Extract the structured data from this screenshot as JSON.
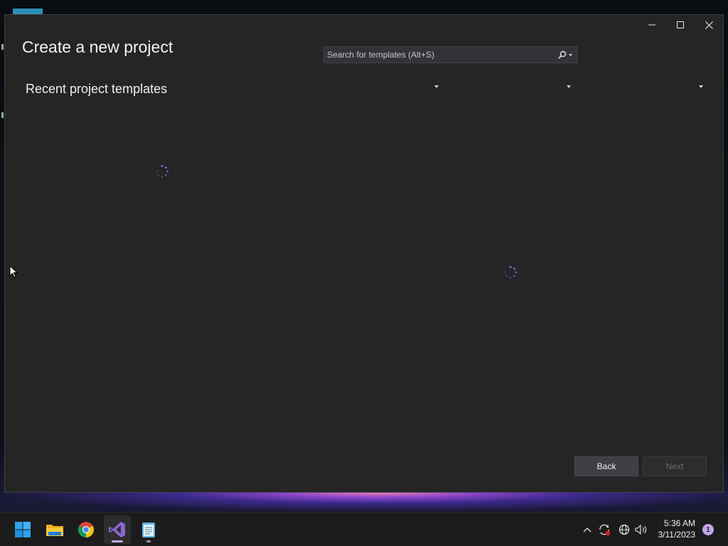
{
  "dialog": {
    "title": "Create a new project",
    "subtitle": "Recent project templates",
    "search": {
      "placeholder": "Search for templates (Alt+S)",
      "value": ""
    },
    "filters": [
      {
        "name": "language-filter",
        "value": ""
      },
      {
        "name": "platform-filter",
        "value": ""
      },
      {
        "name": "project-type-filter",
        "value": ""
      }
    ],
    "buttons": {
      "back": "Back",
      "next": "Next"
    },
    "window_controls": [
      "minimize-icon",
      "maximize-icon",
      "close-icon"
    ],
    "loading": {
      "recent_templates": true,
      "all_templates": true
    }
  },
  "taskbar": {
    "apps": [
      {
        "name": "start-button",
        "icon": "windows-logo-icon",
        "active": false
      },
      {
        "name": "file-explorer",
        "icon": "folder-icon",
        "active": false
      },
      {
        "name": "chrome",
        "icon": "chrome-icon",
        "active": false
      },
      {
        "name": "visual-studio",
        "icon": "visual-studio-icon",
        "active": true
      },
      {
        "name": "notepad",
        "icon": "notepad-icon",
        "active": false
      }
    ],
    "tray": {
      "time": "5:36 AM",
      "date": "3/11/2023",
      "notifications": "1",
      "icons": [
        "chevron-up-icon",
        "sync-icon",
        "network-icon",
        "volume-icon"
      ]
    }
  },
  "colors": {
    "accent": "#8a67d6",
    "window_bg": "#252526",
    "button_bg": "#3f3f46",
    "taskbar_bg": "#1c1c1c"
  }
}
